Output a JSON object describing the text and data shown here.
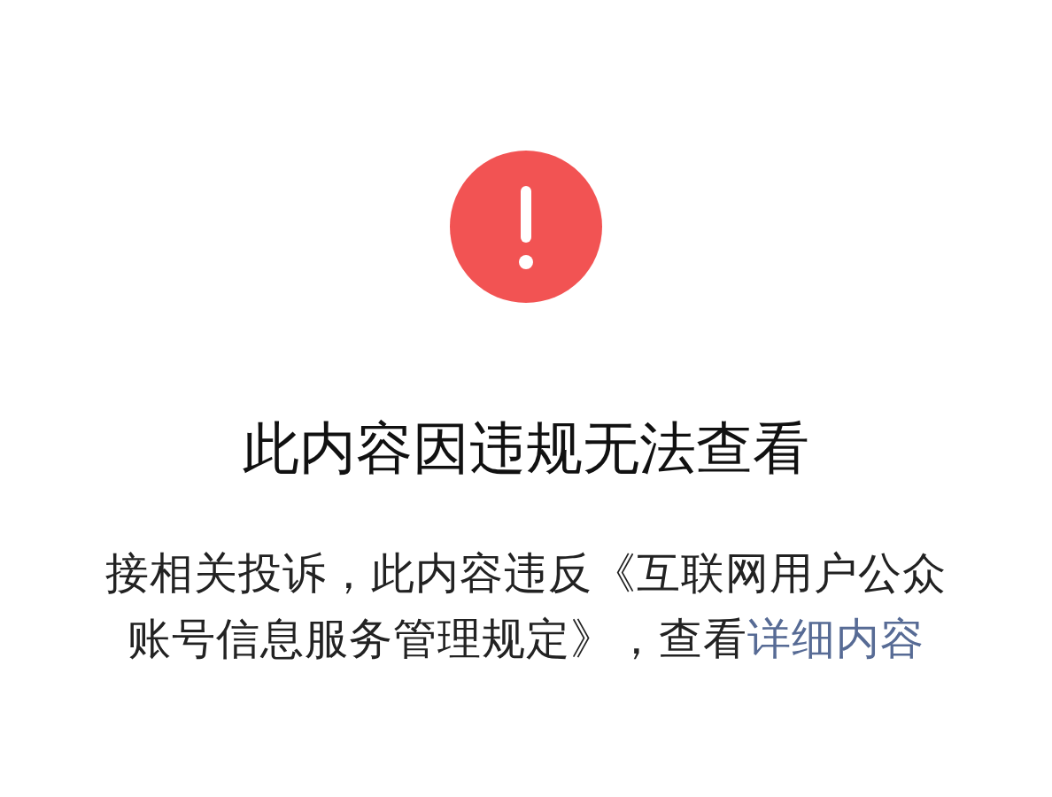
{
  "notice": {
    "kind": "error",
    "title": "此内容因违规无法查看",
    "message": "接相关投诉，此内容违反《互联网用户公众账号信息服务管理规定》，查看",
    "link": "详细内容"
  }
}
